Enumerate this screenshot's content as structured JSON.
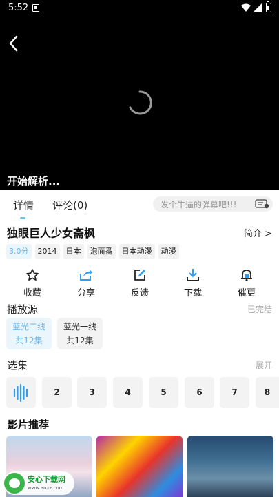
{
  "status_bar": {
    "time": "5:52"
  },
  "player": {
    "loading_text": "开始解析..."
  },
  "tabs": {
    "details": "详情",
    "comments": "评论(0)"
  },
  "danmu": {
    "placeholder": "发个牛逼的弹幕吧!!!"
  },
  "title": {
    "name": "独眼巨人少女斋枫",
    "intro_link": "简介 >"
  },
  "tags": [
    "3.0分",
    "2014",
    "日本",
    "泡面番",
    "日本动漫",
    "动漫"
  ],
  "actions": [
    {
      "label": "收藏",
      "icon": "star-icon"
    },
    {
      "label": "分享",
      "icon": "share-icon"
    },
    {
      "label": "反馈",
      "icon": "edit-icon"
    },
    {
      "label": "下载",
      "icon": "download-icon"
    },
    {
      "label": "催更",
      "icon": "bell-icon"
    }
  ],
  "source": {
    "title": "播放源",
    "status": "已完结",
    "items": [
      {
        "name": "蓝光二线",
        "count": "共12集"
      },
      {
        "name": "蓝光一线",
        "count": "共12集"
      }
    ]
  },
  "episodes": {
    "title": "选集",
    "expand": "展开",
    "items": [
      "2",
      "3",
      "4",
      "5",
      "6",
      "7",
      "8"
    ]
  },
  "recommend": {
    "title": "影片推荐"
  },
  "watermark": {
    "main": "安心下载网",
    "sub": "www.anxz.com"
  },
  "colors": {
    "accent": "#6cb6e8",
    "action_icon": "#2f9ff0"
  }
}
